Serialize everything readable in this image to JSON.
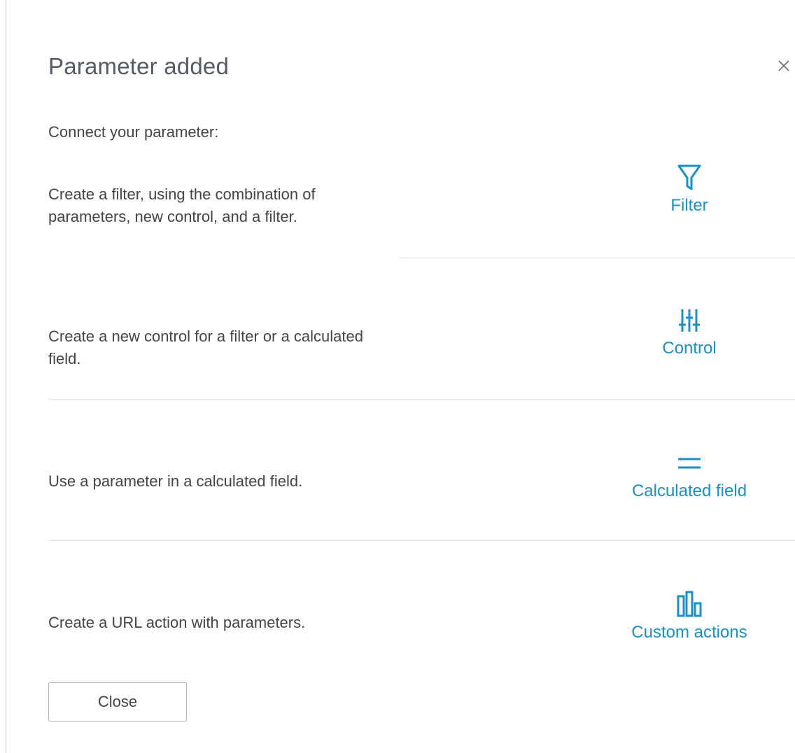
{
  "dialog": {
    "title": "Parameter added",
    "intro": "Connect your parameter:",
    "close_button_label": "Close"
  },
  "rows": [
    {
      "description": "Create a filter, using the combination of parameters, new control, and a filter.",
      "action_label": "Filter",
      "icon": "filter-icon"
    },
    {
      "description": "Create a new control for a filter or a calculated field.",
      "action_label": "Control",
      "icon": "control-sliders-icon"
    },
    {
      "description": "Use a parameter in a calculated field.",
      "action_label": "Calculated field",
      "icon": "equals-icon"
    },
    {
      "description": "Create a URL action with parameters.",
      "action_label": "Custom actions",
      "icon": "bar-chart-icon"
    }
  ],
  "colors": {
    "accent": "#1a8fc9",
    "text": "#444444",
    "title": "#545b64",
    "divider": "#e3e3e3"
  }
}
